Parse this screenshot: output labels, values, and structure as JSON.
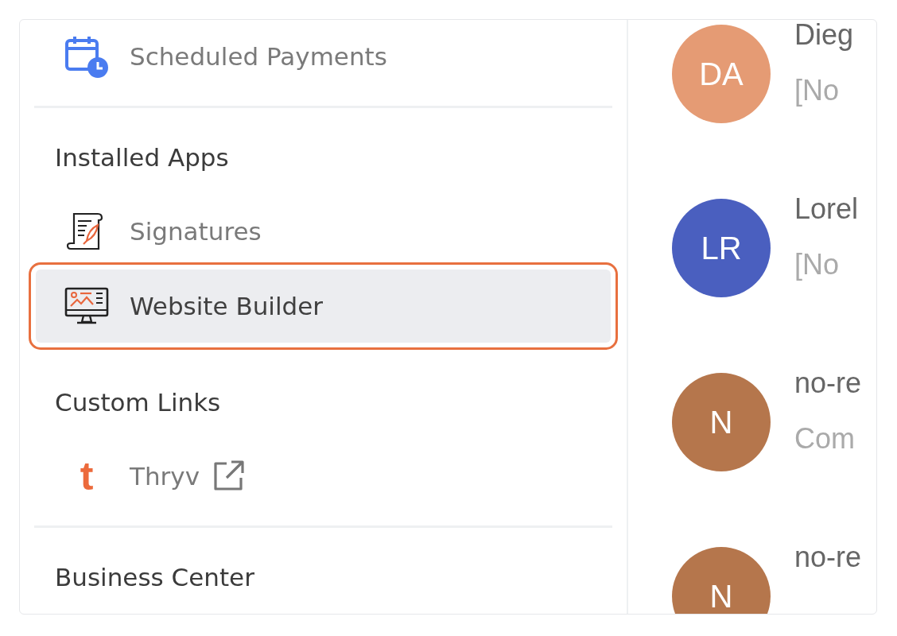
{
  "sidebar": {
    "sections": [
      {
        "kind": "item",
        "label": "Scheduled Payments",
        "selected": false,
        "external": false
      },
      {
        "kind": "divider"
      },
      {
        "kind": "header",
        "label": "Installed Apps"
      },
      {
        "kind": "item",
        "label": "Signatures",
        "selected": false,
        "external": false
      },
      {
        "kind": "item",
        "label": "Website Builder",
        "selected": true,
        "external": false
      },
      {
        "kind": "header",
        "label": "Custom Links"
      },
      {
        "kind": "item",
        "logo_text": "t",
        "label": "Thryv",
        "selected": false,
        "external": true
      },
      {
        "kind": "divider"
      },
      {
        "kind": "header",
        "label": "Business Center"
      }
    ]
  },
  "conversations": [
    {
      "initials": "DA",
      "color": "#e59b74",
      "name": "Dieg",
      "preview": "[No"
    },
    {
      "initials": "LR",
      "color": "#4a5fbf",
      "name": "Lorel",
      "preview": "[No"
    },
    {
      "initials": "N",
      "color": "#b5764c",
      "name": "no-re",
      "preview": "Com"
    },
    {
      "initials": "N",
      "color": "#b5764c",
      "name": "no-re"
    }
  ]
}
